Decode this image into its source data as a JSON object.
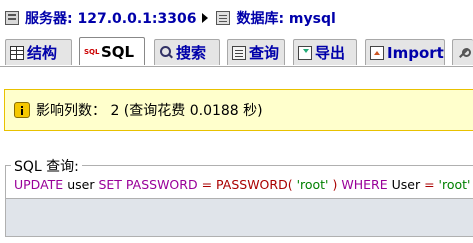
{
  "breadcrumb": {
    "server_label": "服务器: 127.0.0.1:3306",
    "database_label": "数据库: mysql"
  },
  "tabs": [
    {
      "label": "结构",
      "icon": "table-icon"
    },
    {
      "label": "SQL",
      "icon": "sql-icon"
    },
    {
      "label": "搜索",
      "icon": "search-icon"
    },
    {
      "label": "查询",
      "icon": "query-icon"
    },
    {
      "label": "导出",
      "icon": "export-icon"
    },
    {
      "label": "Import",
      "icon": "import-icon"
    },
    {
      "label": "",
      "icon": "operations-icon"
    }
  ],
  "active_tab": "SQL",
  "notice": {
    "text": "影响列数： 2 (查询花费 0.0188 秒)"
  },
  "sql_query": {
    "legend": "SQL 查询:",
    "tokens": [
      "UPDATE",
      "user",
      "SET",
      "PASSWORD",
      "=",
      "PASSWORD(",
      "'root'",
      ")",
      "WHERE",
      "User",
      "=",
      "'root'"
    ]
  },
  "colors": {
    "link": "#0000aa",
    "keyword": "#990099",
    "string": "#008000",
    "function": "#aa0000",
    "notice_bg": "#ffffcc",
    "notice_border": "#e8c100"
  }
}
